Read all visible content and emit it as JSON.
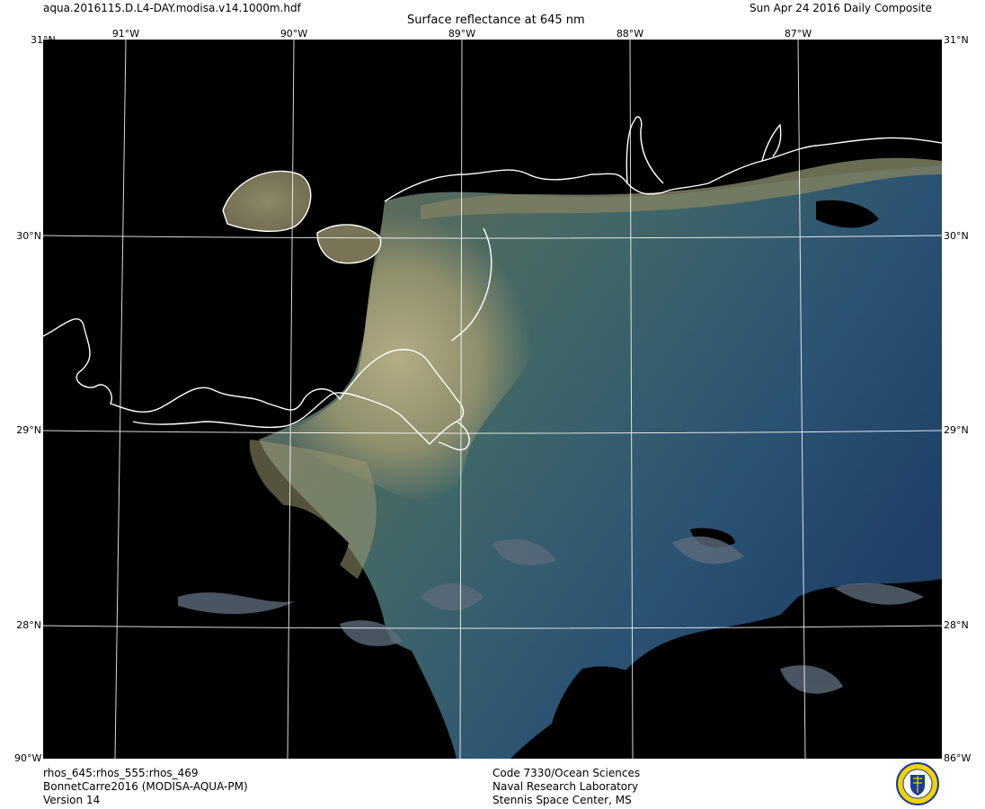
{
  "header": {
    "filename": "aqua.2016115.D.L4-DAY.modisa.v14.1000m.hdf",
    "title": "Surface reflectance at 645 nm",
    "date": "Sun Apr 24 2016 Daily Composite"
  },
  "map": {
    "longitude_labels": [
      "91°W",
      "90°W",
      "89°W",
      "88°W",
      "87°W"
    ],
    "latitude_labels": [
      "30°N",
      "29°N",
      "28°N"
    ],
    "corner_labels": {
      "top_left": "31°N",
      "top_right": "31°N",
      "bottom_left": "90°W",
      "bottom_right": "86°W"
    },
    "colors": {
      "land_mask": "#000000",
      "turbid_plume": "#9a9670",
      "open_gulf": "#24486c",
      "cloud": "#5c6a7a",
      "coastline": "#ffffff",
      "graticule": "#ffffff"
    }
  },
  "footer": {
    "bands": "rhos_645:rhos_555:rhos_469",
    "project": "BonnetCarre2016 (MODISA-AQUA-PM)",
    "version": "Version 14",
    "org_code": "Code 7330/Ocean Sciences",
    "org_name": "Naval Research Laboratory",
    "org_location": "Stennis Space Center, MS"
  },
  "logo": {
    "icon": "nrl-seal-icon",
    "ring_color": "#f2d200",
    "shield_color": "#1a3a9c"
  }
}
